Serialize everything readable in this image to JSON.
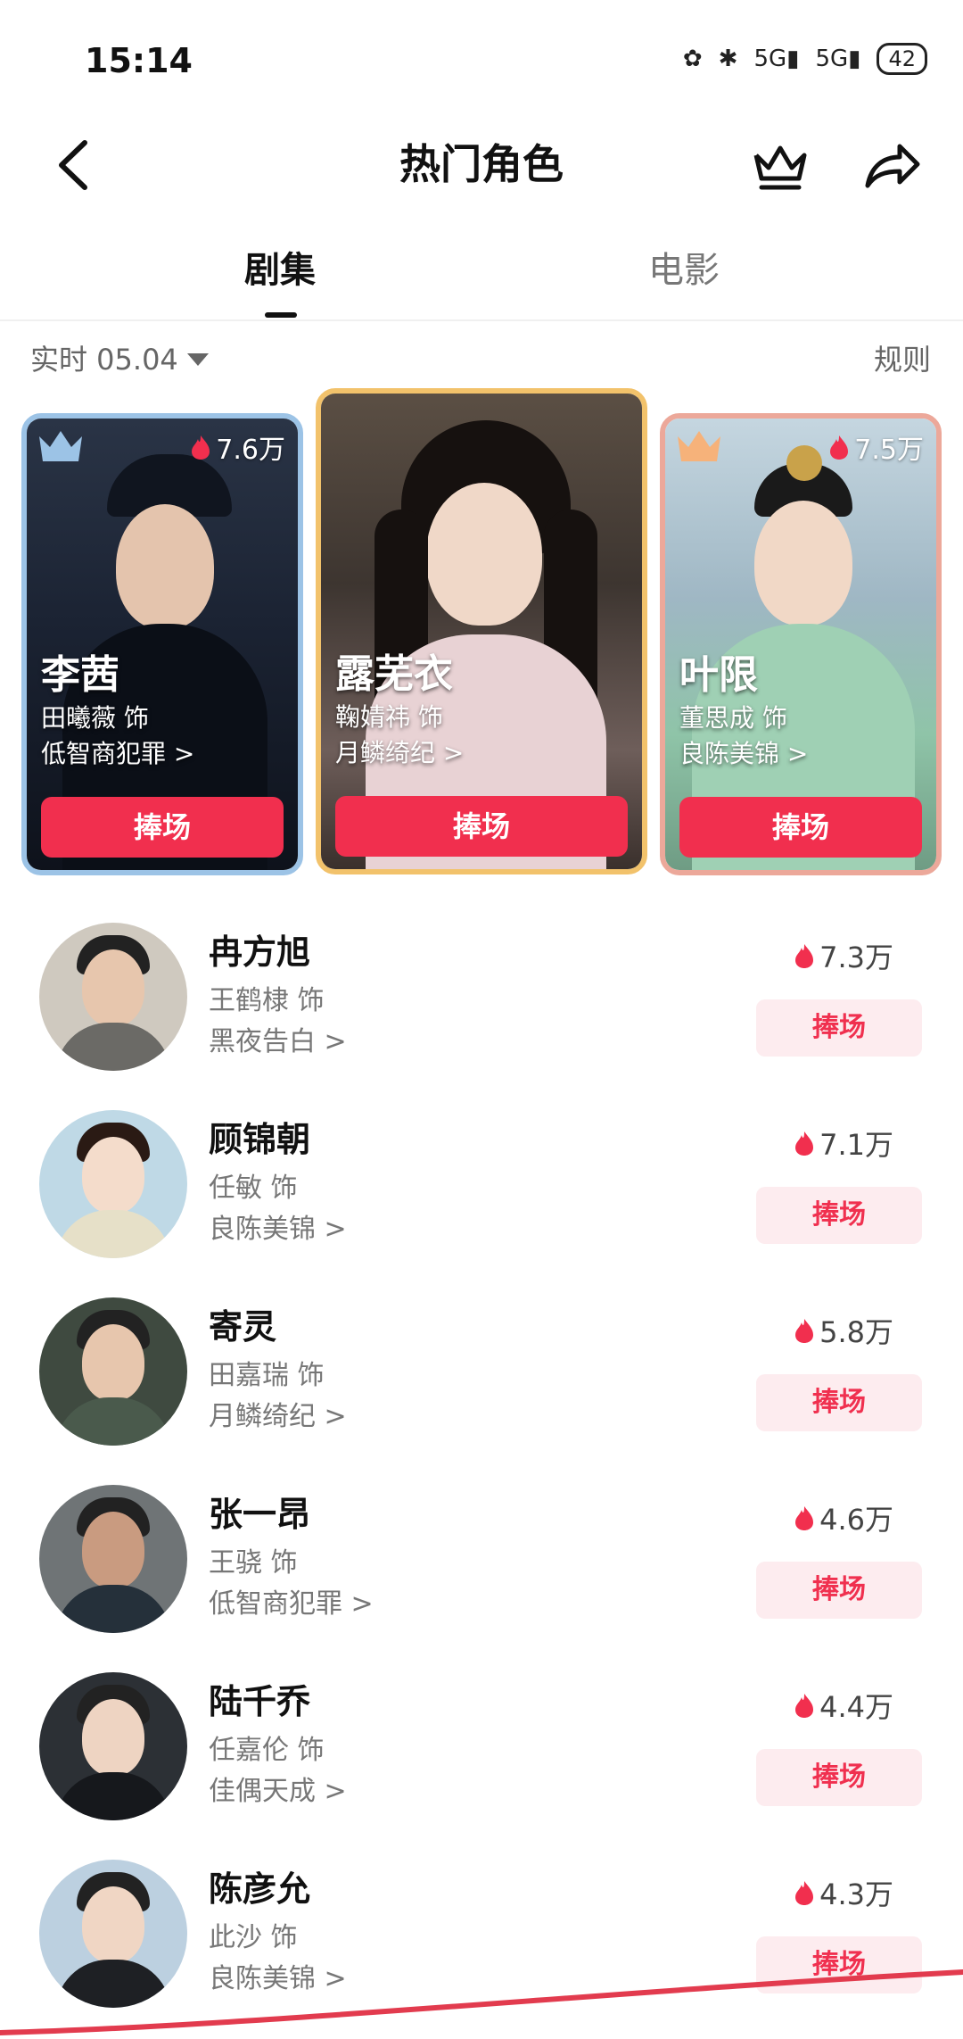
{
  "status_bar": {
    "time": "15:14",
    "battery": "42"
  },
  "header": {
    "title": "热门角色"
  },
  "tabs": [
    {
      "label": "剧集",
      "active": true
    },
    {
      "label": "电影",
      "active": false
    }
  ],
  "filter": {
    "date_label": "实时 05.04",
    "rules_label": "规则"
  },
  "top_cards": [
    {
      "rank": 2,
      "name": "李茜",
      "actor": "田曦薇 饰",
      "drama": "低智商犯罪 >",
      "heat": "7.6万",
      "button": "捧场",
      "badge_color": "#9cc3e6"
    },
    {
      "rank": 1,
      "name": "露芜衣",
      "actor": "鞠婧祎 饰",
      "drama": "月鳞绮纪 >",
      "heat": "",
      "button": "捧场",
      "badge_color": "#f2c26b"
    },
    {
      "rank": 3,
      "name": "叶限",
      "actor": "董思成 饰",
      "drama": "良陈美锦 >",
      "heat": "7.5万",
      "button": "捧场",
      "badge_color": "#eca89a"
    }
  ],
  "list": [
    {
      "name": "冉方旭",
      "actor": "王鹤棣 饰",
      "drama": "黑夜告白 >",
      "heat": "7.3万",
      "button": "捧场"
    },
    {
      "name": "顾锦朝",
      "actor": "任敏 饰",
      "drama": "良陈美锦 >",
      "heat": "7.1万",
      "button": "捧场"
    },
    {
      "name": "寄灵",
      "actor": "田嘉瑞 饰",
      "drama": "月鳞绮纪 >",
      "heat": "5.8万",
      "button": "捧场"
    },
    {
      "name": "张一昂",
      "actor": "王骁 饰",
      "drama": "低智商犯罪 >",
      "heat": "4.6万",
      "button": "捧场"
    },
    {
      "name": "陆千乔",
      "actor": "任嘉伦 饰",
      "drama": "佳偶天成 >",
      "heat": "4.4万",
      "button": "捧场"
    },
    {
      "name": "陈彦允",
      "actor": "此沙 饰",
      "drama": "良陈美锦 >",
      "heat": "4.3万",
      "button": "捧场"
    }
  ],
  "colors": {
    "accent": "#f12f4e",
    "cheer_bg_light": "#fdecef",
    "annotation_line": "#e23b4e"
  }
}
